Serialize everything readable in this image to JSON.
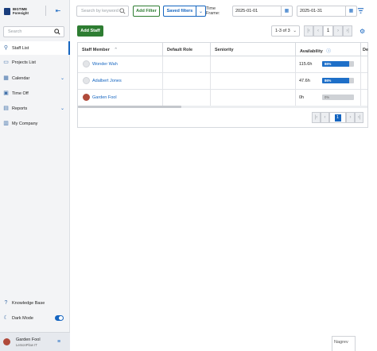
{
  "app": {
    "logo_line1": "BIGTIME",
    "logo_line2": "Foresight",
    "accent_color": "#1565c0",
    "success_color": "#2e7d32"
  },
  "sidebar": {
    "search_placeholder": "Search",
    "items": [
      {
        "label": "Staff List",
        "icon": "people-icon",
        "active": true
      },
      {
        "label": "Projects List",
        "icon": "folder-icon",
        "active": false
      },
      {
        "label": "Calendar",
        "icon": "calendar-icon",
        "expandable": true
      },
      {
        "label": "Time Off",
        "icon": "clock-icon",
        "active": false
      },
      {
        "label": "Reports",
        "icon": "report-icon",
        "expandable": true
      },
      {
        "label": "My Company",
        "icon": "building-icon",
        "active": false
      }
    ],
    "bottom_items": [
      {
        "label": "Knowledge Base",
        "icon": "help-icon"
      },
      {
        "label": "Dark Mode",
        "icon": "moon-icon",
        "toggle_on": true
      }
    ],
    "user": {
      "name": "Garden Fool",
      "org": "LemonPlow IT"
    }
  },
  "toolbar": {
    "search_placeholder": "Search by keyword",
    "add_filter": "Add Filter",
    "saved_filters": "Saved filters",
    "time_frame_label": "Time Frame:",
    "date_from": "2025-01-01",
    "date_to": "2025-01-31"
  },
  "actions": {
    "add_staff": "Add Staff"
  },
  "pagination": {
    "range": "1-3 of 3",
    "current_page": "1"
  },
  "table": {
    "columns": [
      "Staff Member",
      "Default Role",
      "Seniority",
      "Availability",
      "De"
    ],
    "rows": [
      {
        "name": "Wonder Wah",
        "role": "",
        "seniority": "",
        "hours": "115.6h",
        "pct_label": "86%",
        "pct": 0.86,
        "photo": false
      },
      {
        "name": "Adalbert Jones",
        "role": "",
        "seniority": "",
        "hours": "47.6h",
        "pct_label": "86%",
        "pct": 0.86,
        "photo": false
      },
      {
        "name": "Garden Fool",
        "role": "",
        "seniority": "",
        "hours": "0h",
        "pct_label": "0%",
        "pct": 0,
        "photo": true
      }
    ]
  },
  "footer_tab": "Nagrev"
}
